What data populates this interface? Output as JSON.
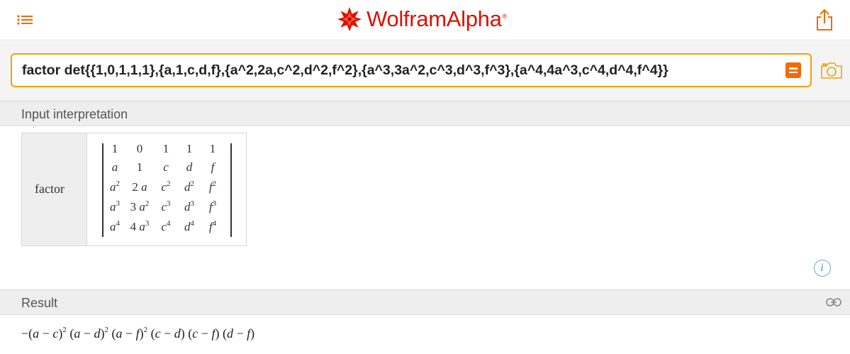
{
  "header": {
    "brand_prefix": "Wolfram",
    "brand_suffix": "Alpha",
    "brand_mark": "®",
    "brand_color": "#dd1100",
    "menu_icon": "hamburger-menu-icon",
    "share_icon": "share-icon"
  },
  "search": {
    "value": "factor det{{1,0,1,1,1},{a,1,c,d,f},{a^2,2a,c^2,d^2,f^2},{a^3,3a^2,c^3,d^3,f^3},{a^4,4a^3,c^4,d^4,f^4}}",
    "accent_color": "#f3a100",
    "submit_icon": "equals-icon",
    "camera_icon": "camera-icon"
  },
  "pods": {
    "input": {
      "title": "Input interpretation",
      "label": "factor",
      "matrix": [
        [
          {
            "base": "1",
            "exp": "",
            "italic": false
          },
          {
            "base": "0",
            "exp": "",
            "italic": false
          },
          {
            "base": "1",
            "exp": "",
            "italic": false
          },
          {
            "base": "1",
            "exp": "",
            "italic": false
          },
          {
            "base": "1",
            "exp": "",
            "italic": false
          }
        ],
        [
          {
            "base": "a",
            "exp": "",
            "italic": true
          },
          {
            "base": "1",
            "exp": "",
            "italic": false
          },
          {
            "base": "c",
            "exp": "",
            "italic": true
          },
          {
            "base": "d",
            "exp": "",
            "italic": true
          },
          {
            "base": "f",
            "exp": "",
            "italic": true
          }
        ],
        [
          {
            "base": "a",
            "exp": "2",
            "italic": true
          },
          {
            "coef": "2",
            "base": "a",
            "exp": "",
            "italic": true
          },
          {
            "base": "c",
            "exp": "2",
            "italic": true
          },
          {
            "base": "d",
            "exp": "2",
            "italic": true
          },
          {
            "base": "f",
            "exp": "2",
            "italic": true
          }
        ],
        [
          {
            "base": "a",
            "exp": "3",
            "italic": true
          },
          {
            "coef": "3",
            "base": "a",
            "exp": "2",
            "italic": true
          },
          {
            "base": "c",
            "exp": "3",
            "italic": true
          },
          {
            "base": "d",
            "exp": "3",
            "italic": true
          },
          {
            "base": "f",
            "exp": "3",
            "italic": true
          }
        ],
        [
          {
            "base": "a",
            "exp": "4",
            "italic": true
          },
          {
            "coef": "4",
            "base": "a",
            "exp": "3",
            "italic": true
          },
          {
            "base": "c",
            "exp": "4",
            "italic": true
          },
          {
            "base": "d",
            "exp": "4",
            "italic": true
          },
          {
            "base": "f",
            "exp": "4",
            "italic": true
          }
        ]
      ],
      "info_icon": "info-icon"
    },
    "result": {
      "title": "Result",
      "link_icon": "link-icon",
      "factors": [
        {
          "lead": "−(",
          "a": "a",
          "op": " − ",
          "b": "c",
          "exp": "2"
        },
        {
          "lead": " (",
          "a": "a",
          "op": " − ",
          "b": "d",
          "exp": "2"
        },
        {
          "lead": " (",
          "a": "a",
          "op": " − ",
          "b": "f",
          "exp": "2"
        },
        {
          "lead": " (",
          "a": "c",
          "op": " − ",
          "b": "d",
          "exp": ""
        },
        {
          "lead": " (",
          "a": "c",
          "op": " − ",
          "b": "f",
          "exp": ""
        },
        {
          "lead": " (",
          "a": "d",
          "op": " − ",
          "b": "f",
          "exp": ""
        }
      ]
    }
  }
}
